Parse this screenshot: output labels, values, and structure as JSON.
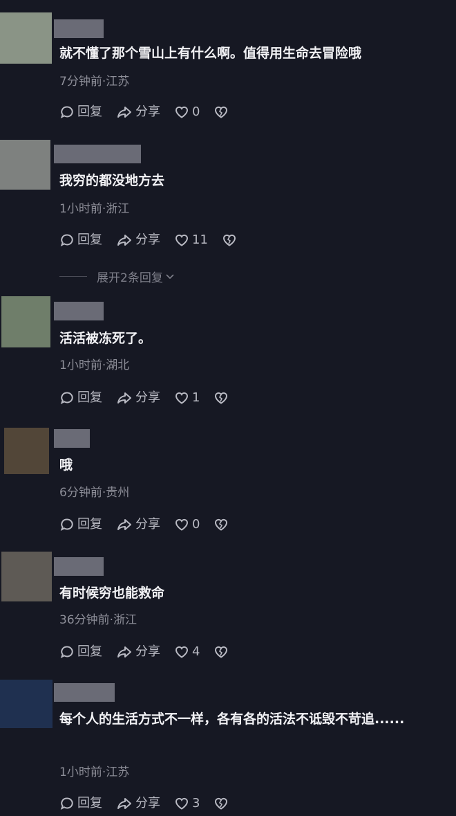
{
  "comments": [
    {
      "text": "就不懂了那个雪山上有什么啊。值得用生命去冒险哦",
      "meta": "7分钟前·江苏",
      "reply_label": "回复",
      "share_label": "分享",
      "likes": "0",
      "avatar_color": "#8a9486"
    },
    {
      "text": "我穷的都没地方去",
      "meta": "1小时前·浙江",
      "reply_label": "回复",
      "share_label": "分享",
      "likes": "11",
      "avatar_color": "#7e817f"
    },
    {
      "text": "活活被冻死了。",
      "meta": "1小时前·湖北",
      "reply_label": "回复",
      "share_label": "分享",
      "likes": "1",
      "avatar_color": "#6f7e6a"
    },
    {
      "text": "哦",
      "meta": "6分钟前·贵州",
      "reply_label": "回复",
      "share_label": "分享",
      "likes": "0",
      "avatar_color": "#524638"
    },
    {
      "text": "有时候穷也能救命",
      "meta": "36分钟前·浙江",
      "reply_label": "回复",
      "share_label": "分享",
      "likes": "4",
      "avatar_color": "#5e5a55"
    },
    {
      "text": "每个人的生活方式不一样，各有各的活法不诋毁不苛追......",
      "meta": "1小时前·江苏",
      "reply_label": "回复",
      "share_label": "分享",
      "likes": "3",
      "avatar_color": "#1f3050"
    }
  ],
  "expand_replies": "展开2条回复"
}
